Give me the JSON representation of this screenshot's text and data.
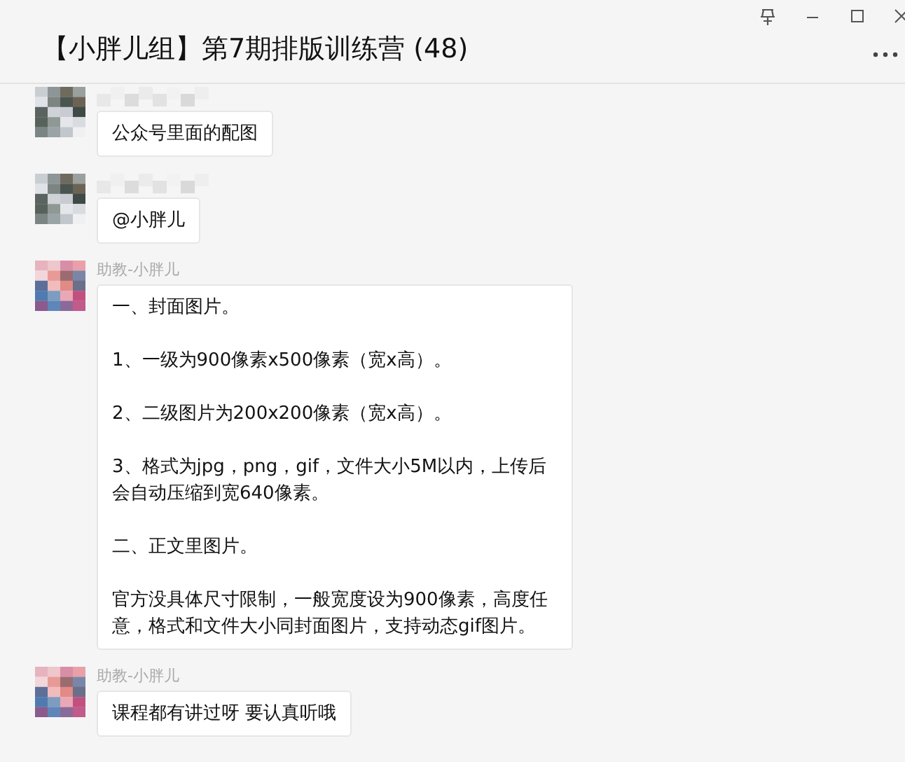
{
  "window": {
    "title": "【小胖儿组】第7期排版训练营 (48)"
  },
  "messages": [
    {
      "sender": {
        "kind": "blurred"
      },
      "paragraphs": [
        "公众号里面的配图"
      ]
    },
    {
      "sender": {
        "kind": "blurred"
      },
      "paragraphs": [
        "@小胖儿"
      ]
    },
    {
      "sender": {
        "kind": "named",
        "name": "助教-小胖儿"
      },
      "paragraphs": [
        "一、封面图片。",
        "1、一级为900像素x500像素（宽x高）。",
        "2、二级图片为200x200像素（宽x高）。",
        "3、格式为jpg，png，gif，文件大小5M以内，上传后会自动压缩到宽640像素。",
        "二、正文里图片。",
        "官方没具体尺寸限制，一般宽度设为900像素，高度任意，格式和文件大小同封面图片，支持动态gif图片。"
      ]
    },
    {
      "sender": {
        "kind": "named",
        "name": "助教-小胖儿"
      },
      "paragraphs": [
        "课程都有讲过呀 要认真听哦"
      ]
    }
  ]
}
